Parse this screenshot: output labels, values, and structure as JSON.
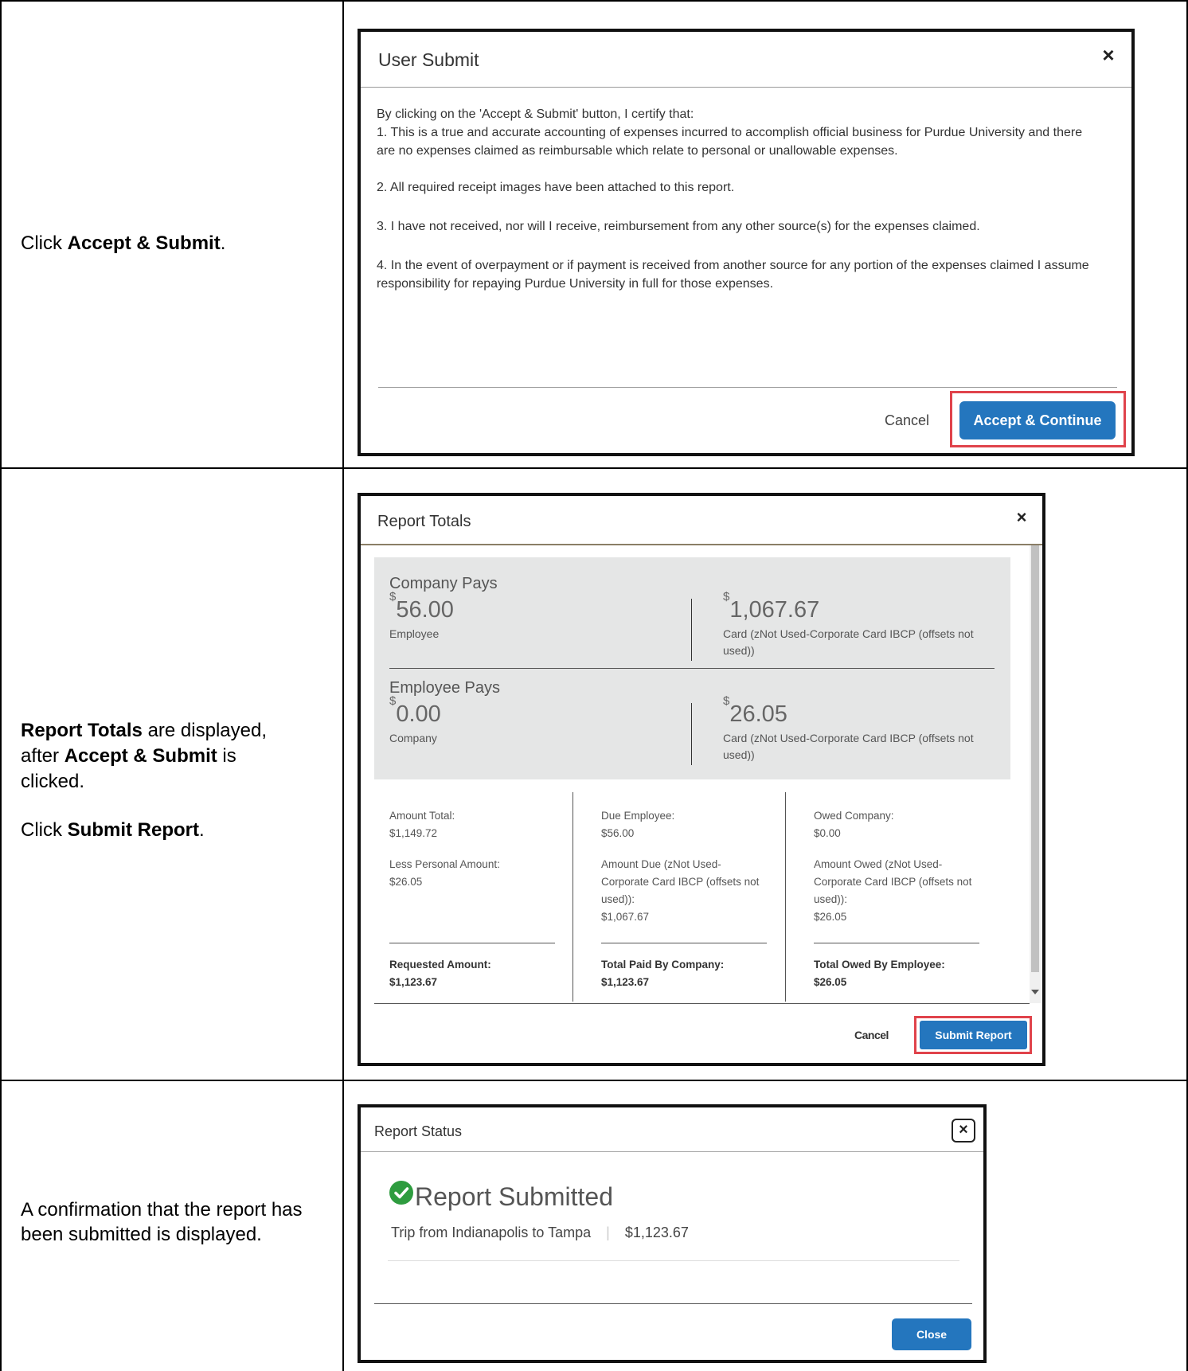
{
  "rows": [
    {
      "instruction": {
        "pre": "Click ",
        "bold": "Accept & Submit",
        "post": "."
      },
      "dialog": {
        "title": "User Submit",
        "close_symbol": "×",
        "intro": "By clicking on the 'Accept & Submit'  button, I certify that:",
        "items": [
          "1. This is a true and accurate accounting of expenses incurred to accomplish official business for Purdue University and there are no expenses claimed as reimbursable which relate to personal or unallowable expenses.",
          "2. All required receipt images have been attached to this report.",
          "3. I have not received, nor will I receive, reimbursement from any other source(s) for the expenses claimed.",
          "4. In the event of overpayment or if payment is received from another source for any portion of the expenses claimed I assume responsibility for repaying Purdue University in full for those expenses."
        ],
        "cancel_label": "Cancel",
        "primary_label": "Accept & Continue"
      }
    },
    {
      "instruction": {
        "line1_bold": "Report Totals",
        "line1_rest": " are displayed,",
        "line2_pre": "after ",
        "line2_bold": "Accept & Submit",
        "line2_post": " is",
        "line3": "clicked.",
        "line4_pre": "Click ",
        "line4_bold": "Submit Report",
        "line4_post": "."
      },
      "dialog": {
        "title": "Report Totals",
        "close_symbol": "×",
        "company_pays": {
          "heading": "Company Pays",
          "left": {
            "currency": "$",
            "amount": "56.00",
            "label": "Employee"
          },
          "right": {
            "currency": "$",
            "amount": "1,067.67",
            "label": "Card (zNot Used-Corporate Card IBCP (offsets not used))"
          }
        },
        "employee_pays": {
          "heading": "Employee Pays",
          "left": {
            "currency": "$",
            "amount": "0.00",
            "label": "Company"
          },
          "right": {
            "currency": "$",
            "amount": "26.05",
            "label": "Card (zNot Used-Corporate Card IBCP (offsets not used))"
          }
        },
        "col1": {
          "l1": "Amount Total:",
          "v1": "$1,149.72",
          "l2": "Less Personal Amount:",
          "v2": "$26.05",
          "total_label": "Requested Amount:",
          "total_value": "$1,123.67"
        },
        "col2": {
          "l1": "Due Employee:",
          "v1": "$56.00",
          "l2": "Amount Due (zNot Used-Corporate Card IBCP (offsets not used)):",
          "v2": "$1,067.67",
          "total_label": "Total Paid By Company:",
          "total_value": "$1,123.67"
        },
        "col3": {
          "l1": "Owed Company:",
          "v1": "$0.00",
          "l2": "Amount Owed (zNot Used-Corporate Card IBCP (offsets not used)):",
          "v2": "$26.05",
          "total_label": "Total Owed By Employee:",
          "total_value": "$26.05"
        },
        "cancel_label": "Cancel",
        "primary_label": "Submit Report"
      }
    },
    {
      "instruction": {
        "text": "A confirmation that the report has been submitted is displayed."
      },
      "dialog": {
        "title": "Report Status",
        "close_symbol": "×",
        "heading": "Report Submitted",
        "report_name": "Trip from Indianapolis to Tampa",
        "separator": "|",
        "amount": "$1,123.67",
        "close_label": "Close"
      }
    }
  ],
  "colors": {
    "primary": "#2476be",
    "highlight": "#e0434b",
    "success": "#2e9c3f",
    "panel_gray": "#e5e6e6"
  },
  "icons": [
    "close-icon",
    "check-circle-icon",
    "scroll-down-arrow-icon"
  ]
}
